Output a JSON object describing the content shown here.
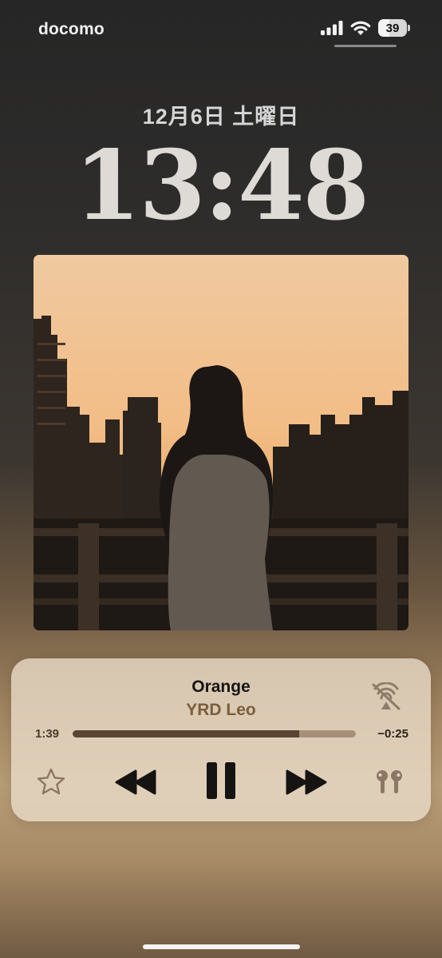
{
  "status_bar": {
    "carrier": "docomo",
    "battery_percent": "39",
    "battery_level": 0.39,
    "signal_icon": "cellular-signal-icon",
    "wifi_icon": "wifi-icon",
    "battery_icon": "battery-icon"
  },
  "lock_screen": {
    "date": "12月6日 土曜日",
    "time": "13:48"
  },
  "artwork": {
    "icon": "album-artwork-image"
  },
  "now_playing": {
    "title": "Orange",
    "artist": "YRD Leo",
    "elapsed": "1:39",
    "remaining": "−0:25",
    "progress": 0.8,
    "controls": {
      "favorite_icon": "star-icon",
      "previous_icon": "rewind-icon",
      "play_pause_icon": "pause-icon",
      "next_icon": "fast-forward-icon",
      "output_icon": "airpods-icon",
      "airplay_icon": "airplay-disabled-icon"
    }
  },
  "colors": {
    "artist_text": "#7b5e3d",
    "progress_fill": "#5a4533",
    "progress_track": "#a6907a",
    "sky_top": "#f0c9a0",
    "sky_horizon": "#e7a866"
  }
}
